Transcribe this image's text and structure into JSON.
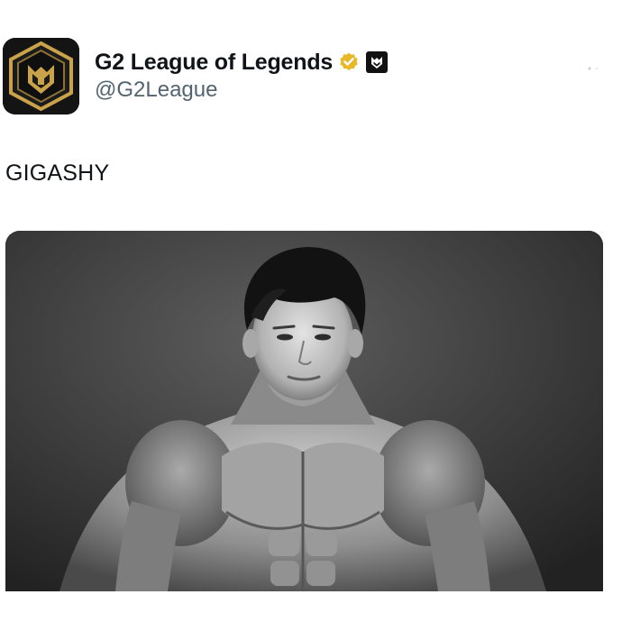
{
  "author": {
    "display_name": "G2 League of Legends",
    "handle": "@G2League",
    "avatar": "g2-esports-logo",
    "badges": [
      "verified-badge-icon",
      "g2-affiliate-badge-icon"
    ]
  },
  "tweet": {
    "text": "GIGASHY"
  },
  "media": {
    "type": "image",
    "description_icon": "muscular-man-photo"
  },
  "colors": {
    "text_primary": "#0f1419",
    "text_secondary": "#536471",
    "verified_gold": "#e8b829",
    "avatar_gold": "#c9a24a"
  }
}
